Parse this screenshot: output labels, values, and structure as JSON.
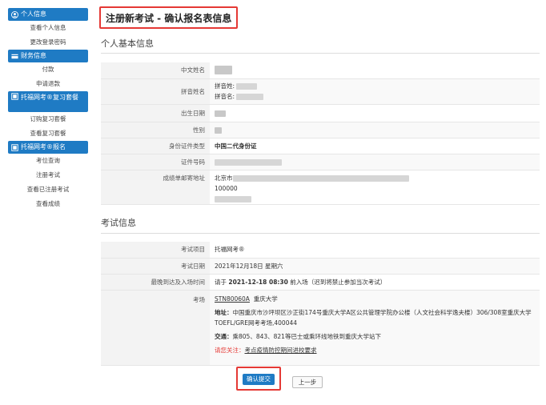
{
  "sidebar": {
    "groups": [
      {
        "title": "个人信息",
        "items": [
          "查看个人信息",
          "更改登录密码"
        ]
      },
      {
        "title": "财务信息",
        "items": [
          "付款",
          "申请退款"
        ]
      },
      {
        "title": "托福网考®复习套餐",
        "items": [
          "订购复习套餐",
          "查看复习套餐"
        ]
      },
      {
        "title": "托福网考®报名",
        "items": [
          "考位查询",
          "注册考试",
          "查看已注册考试",
          "查看成绩"
        ]
      }
    ]
  },
  "page": {
    "title": "注册新考试 - 确认报名表信息"
  },
  "personal": {
    "section_title": "个人基本信息",
    "labels": {
      "chinese_name": "中文姓名",
      "pinyin_name": "拼音姓名",
      "birth_date": "出生日期",
      "gender": "性别",
      "id_type": "身份证件类型",
      "id_number": "证件号码",
      "mail_address": "成绩单邮寄地址"
    },
    "pinyin_last_label": "拼音姓:",
    "pinyin_first_label": "拼音名:",
    "id_type_value": "中国二代身份证",
    "address_city": "北京市",
    "address_zip": "100000"
  },
  "exam": {
    "section_title": "考试信息",
    "labels": {
      "item": "考试项目",
      "date": "考试日期",
      "arrival": "最晚到达及入场时间",
      "center": "考场"
    },
    "item_value": "托福网考®",
    "date_value": "2021年12月18日 星期六",
    "arrival_prefix": "请于",
    "arrival_time": "2021-12-18 08:30",
    "arrival_suffix": "前入场（迟到将禁止参加当次考试）",
    "center_code": "STN80060A",
    "center_name": "重庆大学",
    "address_label": "地址：",
    "address_text": "中国重庆市沙坪坝区沙正街174号重庆大学A区公共管理学院办公楼（人文社会科学逸夫楼）306/308室重庆大学TOEFL/GRE网考考场,400044",
    "traffic_label": "交通：",
    "traffic_text": "乘805、843、821等巴士或乘环线地铁到重庆大学站下",
    "notice_label": "请您关注：",
    "notice_link": "考点疫情防控期间进校要求"
  },
  "actions": {
    "confirm_label": "确认提交",
    "back_label": "上一步"
  }
}
